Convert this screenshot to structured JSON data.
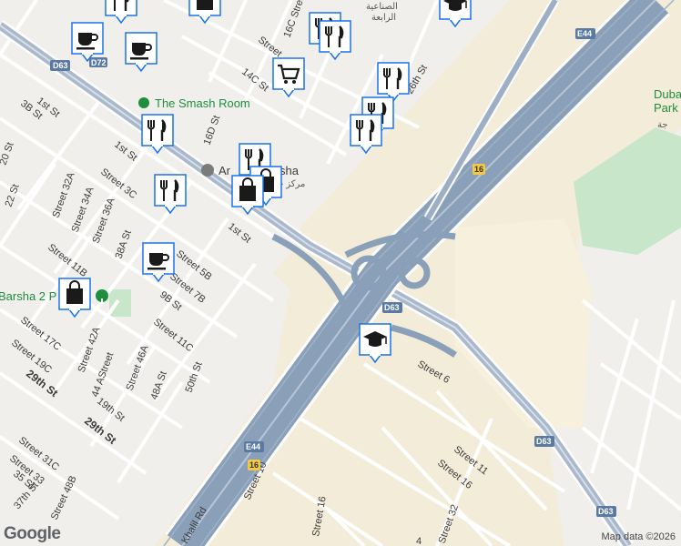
{
  "streets": {
    "st_1st_a": "1st St",
    "st_1st_b": "1st St",
    "st_1st_c": "1st St",
    "st_3b": "3B St",
    "st_20": "20 St",
    "st_22": "22 St",
    "st_32a": "Street 32A",
    "st_34a": "Street 34A",
    "st_36a": "Street 36A",
    "st_38a": "38A St",
    "st_3c": "Street 3C",
    "st_11b": "Street 11B",
    "st_5b": "Street 5B",
    "st_7b": "Street 7B",
    "st_9b": "9B St",
    "st_11c": "Street 11C",
    "st_17c": "Street 17C",
    "st_19c": "Street 19C",
    "st_42a": "Street 42A",
    "st_44a": "44 AStreet",
    "st_46a": "Street 46A",
    "st_48a": "48A St",
    "st_50th": "50th St",
    "st_29th_a": "29th St",
    "st_29th_b": "29th St",
    "st_19th": "19th St",
    "st_31c": "Street 31C",
    "st_33": "Street 33",
    "st_35": "35 St",
    "st_37th": "37th St",
    "st_48b": "Street 48B",
    "st_16c": "16C Street",
    "st_14c": "14C St",
    "st_16d": "16D St",
    "st_26th": "26th St",
    "st_street": "Street",
    "st_6": "Street 6",
    "st_10": "Street 10",
    "st_11": "Street 11",
    "st_16a": "Street 16",
    "st_16b": "Street 16",
    "st_32": "Street 32",
    "st_khalil": "Khalil Rd",
    "st_4": "4"
  },
  "places": {
    "smash_room": "The Smash Room",
    "al_barsha_partial": "Ar",
    "al_barsha_partial2": "sha",
    "al_barsha_ar": "مركز خد",
    "barsha2_park": "Barsha 2 P",
    "dubai_park_line1": "Duba",
    "dubai_park_line2": "Park",
    "arabic_industrial_1": "الصناعية",
    "arabic_industrial_2": "الرابعة",
    "arabic_side": "جة"
  },
  "shields": {
    "d63_a": "D63",
    "d63_b": "D63",
    "d63_c": "D63",
    "d63_d": "D63",
    "d72": "D72",
    "e44_a": "E44",
    "e44_b": "E44",
    "r16_a": "16",
    "r16_b": "16"
  },
  "pois": [
    {
      "icon": "restaurant-icon"
    },
    {
      "icon": "shopping-bag-icon"
    },
    {
      "icon": "school-icon"
    },
    {
      "icon": "restaurant-icon"
    },
    {
      "icon": "cafe-icon"
    },
    {
      "icon": "cafe-icon"
    },
    {
      "icon": "shopping-cart-icon"
    },
    {
      "icon": "restaurant-icon"
    },
    {
      "icon": "restaurant-icon"
    },
    {
      "icon": "restaurant-icon"
    },
    {
      "icon": "restaurant-icon"
    },
    {
      "icon": "restaurant-icon"
    },
    {
      "icon": "restaurant-icon"
    },
    {
      "icon": "shopping-bag-icon"
    },
    {
      "icon": "cafe-icon"
    },
    {
      "icon": "shopping-bag-icon"
    },
    {
      "icon": "school-icon"
    }
  ],
  "footer": {
    "google_logo": "Google",
    "map_data": "Map data ©2026"
  },
  "colors": {
    "land": "#f0efec",
    "desert": "#f3ecd9",
    "highway": "#8a9fb8",
    "road": "#ffffff",
    "park": "#c8e6c9",
    "poi_blue": "#1a73e8"
  }
}
